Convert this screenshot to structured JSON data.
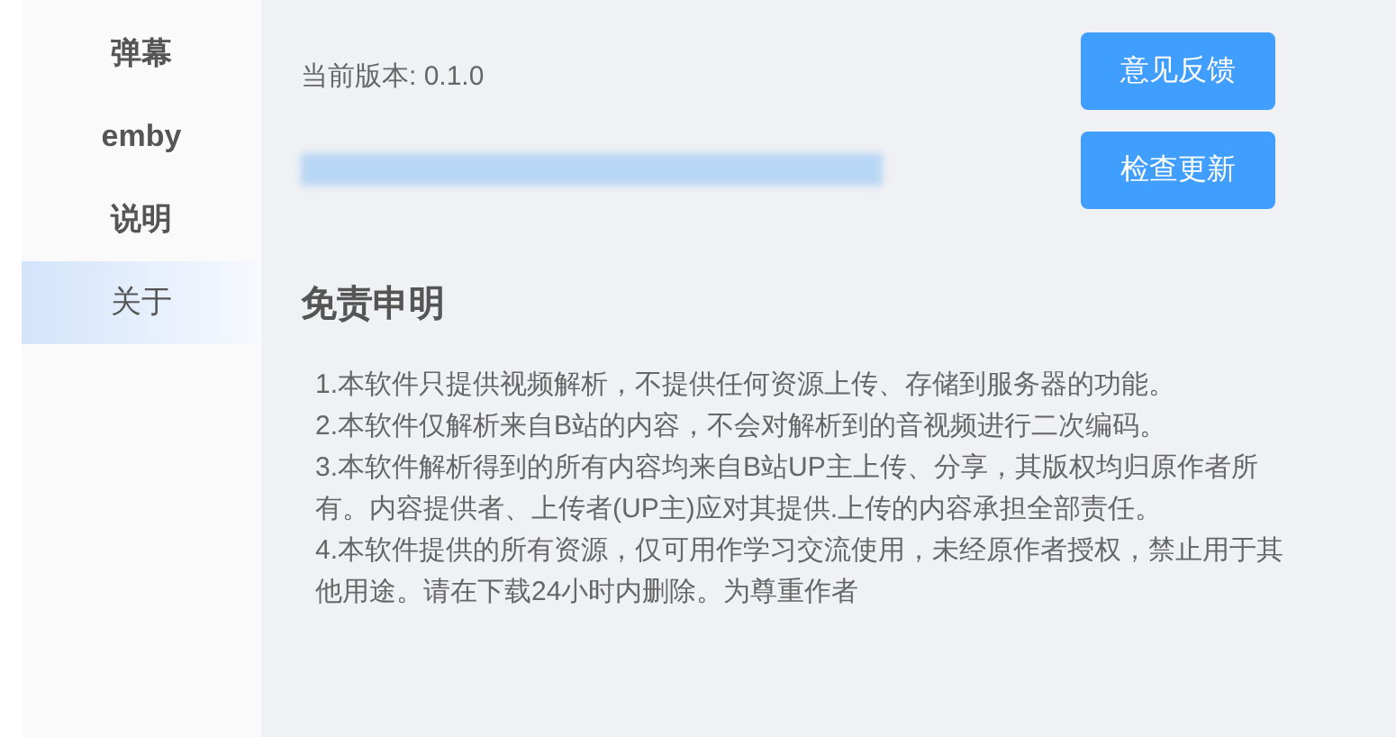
{
  "sidebar": {
    "items": [
      {
        "label": "弹幕",
        "selected": false
      },
      {
        "label": "emby",
        "selected": false
      },
      {
        "label": "说明",
        "selected": false
      },
      {
        "label": "关于",
        "selected": true
      }
    ]
  },
  "about": {
    "version": "当前版本: 0.1.0",
    "buttons": [
      "意见反馈",
      "检查更新"
    ]
  },
  "disclaimer": {
    "title": "免责申明",
    "paragraphs": [
      "1.本软件只提供视频解析，不提供任何资源上传、存储到服务器的功能。",
      "2.本软件仅解析来自B站的内容，不会对解析到的音视频进行二次编码。",
      "3.本软件解析得到的所有内容均来自B站UP主上传、分享，其版权均归原作者所有。内容提供者、上传者(UP主)应对其提供.上传的内容承担全部责任。",
      "4.本软件提供的所有资源，仅可用作学习交流使用，未经原作者授权，禁止用于其他用途。请在下载24小时内删除。为尊重作者"
    ]
  }
}
